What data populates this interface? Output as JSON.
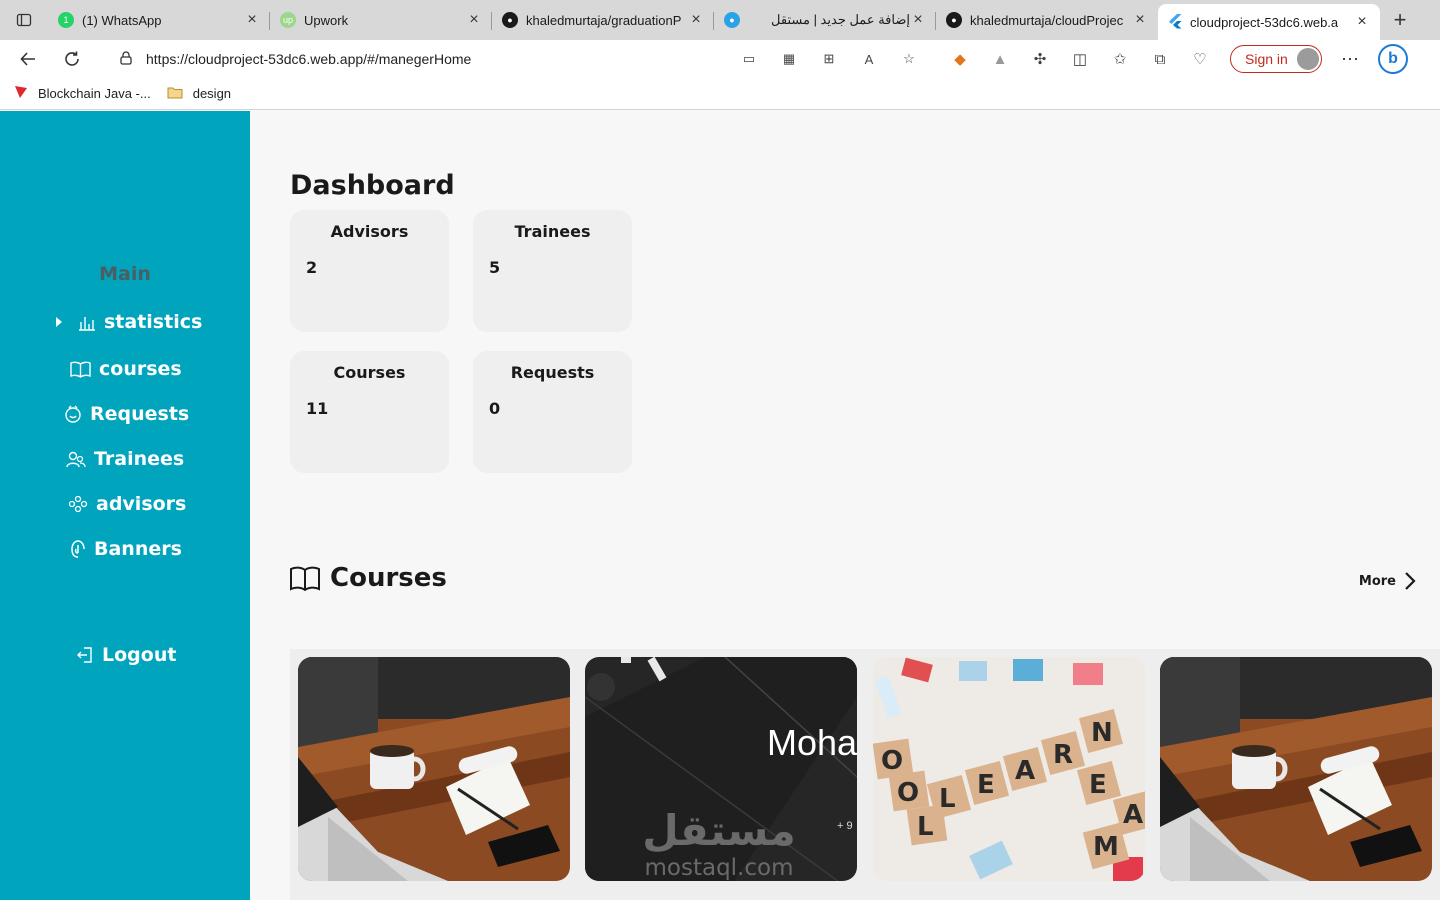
{
  "browser": {
    "tabs": [
      {
        "title": "(1) WhatsApp",
        "favicon": "whatsapp-icon",
        "color": "#25d366"
      },
      {
        "title": "Upwork",
        "favicon": "upwork-icon",
        "color": "#9bd68a"
      },
      {
        "title": "khaledmurtaja/graduationP",
        "favicon": "github-icon",
        "color": "#1a1a1a"
      },
      {
        "title": "إضافة عمل جديد | مستقل",
        "favicon": "mostaql-icon",
        "color": "#2aa3e6"
      },
      {
        "title": "khaledmurtaja/cloudProjec",
        "favicon": "github-icon",
        "color": "#1a1a1a"
      },
      {
        "title": "cloudproject-53dc6.web.a",
        "favicon": "flutter-icon",
        "color": "#42a5f5"
      }
    ],
    "url": "https://cloudproject-53dc6.web.app/#/manegerHome",
    "signin_label": "Sign in",
    "bookmarks": [
      {
        "label": "Blockchain Java -...",
        "icon": "tron-icon"
      },
      {
        "label": "design",
        "icon": "folder-icon"
      }
    ]
  },
  "sidebar": {
    "section_label": "Main",
    "items": [
      {
        "label": "statistics",
        "icon": "bar-chart-icon"
      },
      {
        "label": "courses",
        "icon": "book-icon"
      },
      {
        "label": "Requests",
        "icon": "requests-icon"
      },
      {
        "label": "Trainees",
        "icon": "users-icon"
      },
      {
        "label": "advisors",
        "icon": "group-icon"
      },
      {
        "label": "Banners",
        "icon": "banner-icon"
      }
    ],
    "logout_label": "Logout"
  },
  "dashboard": {
    "title": "Dashboard",
    "stats": [
      {
        "label": "Advisors",
        "value": "2"
      },
      {
        "label": "Trainees",
        "value": "5"
      },
      {
        "label": "Courses",
        "value": "11"
      },
      {
        "label": "Requests",
        "value": "0"
      }
    ]
  },
  "courses": {
    "title": "Courses",
    "more_label": "More",
    "card_texts": {
      "banner_name": "Moha",
      "banner_phone": "+ 9",
      "watermark_ar": "مستقل",
      "watermark_en": "mostaql.com",
      "tile_letters": [
        "L",
        "E",
        "A",
        "R",
        "N",
        "O",
        "O",
        "L",
        "E",
        "M",
        "A"
      ]
    }
  },
  "colors": {
    "sidebar": "#00a4bd",
    "main_bg": "#f7f7f7",
    "card_bg": "#efefef",
    "section_label": "#4a5e63"
  }
}
